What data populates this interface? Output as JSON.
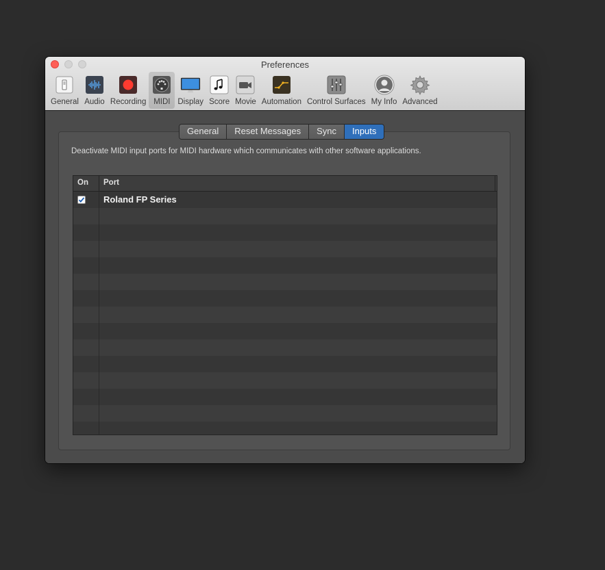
{
  "window": {
    "title": "Preferences"
  },
  "toolbar": {
    "items": [
      {
        "label": "General",
        "icon": "general-icon"
      },
      {
        "label": "Audio",
        "icon": "audio-icon"
      },
      {
        "label": "Recording",
        "icon": "recording-icon"
      },
      {
        "label": "MIDI",
        "icon": "midi-icon",
        "selected": true
      },
      {
        "label": "Display",
        "icon": "display-icon"
      },
      {
        "label": "Score",
        "icon": "score-icon"
      },
      {
        "label": "Movie",
        "icon": "movie-icon"
      },
      {
        "label": "Automation",
        "icon": "automation-icon"
      },
      {
        "label": "Control Surfaces",
        "icon": "control-surfaces-icon"
      },
      {
        "label": "My Info",
        "icon": "my-info-icon"
      },
      {
        "label": "Advanced",
        "icon": "advanced-icon"
      }
    ]
  },
  "tabs": {
    "items": [
      "General",
      "Reset Messages",
      "Sync",
      "Inputs"
    ],
    "active": "Inputs"
  },
  "description": "Deactivate MIDI input ports for MIDI hardware which communicates with other software applications.",
  "table": {
    "headers": {
      "on": "On",
      "port": "Port"
    },
    "rows": [
      {
        "on": true,
        "port": "Roland FP Series"
      }
    ]
  },
  "colors": {
    "accent": "#2f6fba",
    "close": "#fe5f57",
    "background": "#2c2c2c"
  }
}
